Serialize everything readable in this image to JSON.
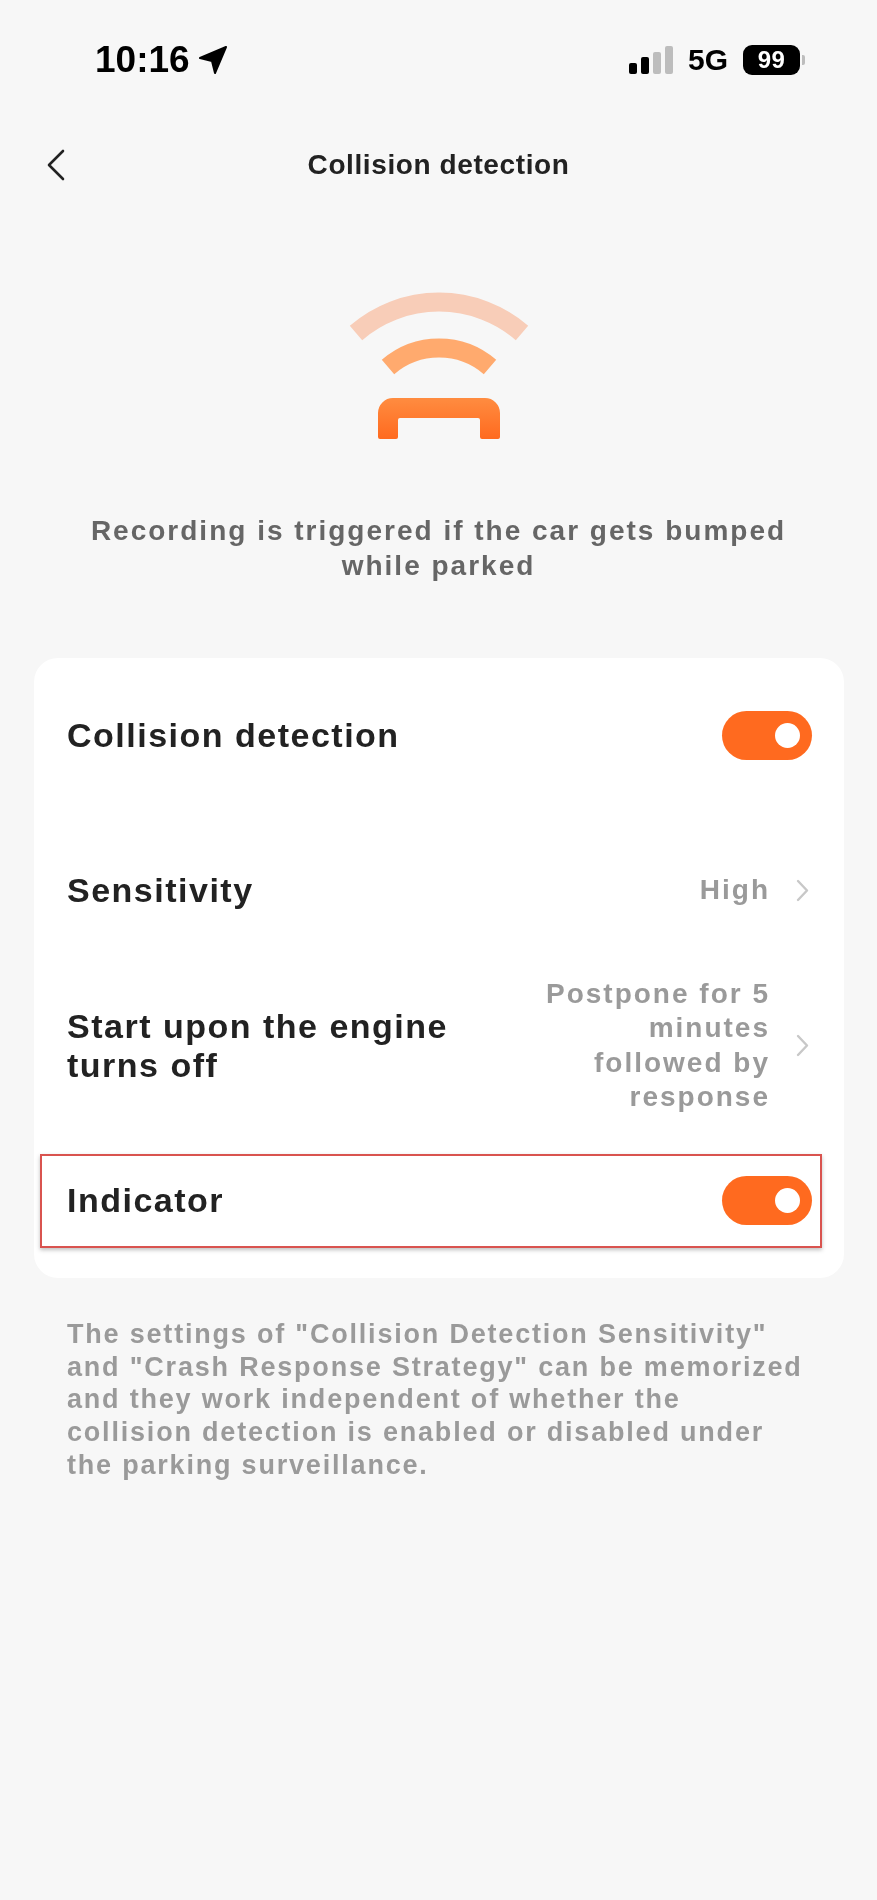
{
  "status_bar": {
    "time": "10:16",
    "network": "5G",
    "battery": "99"
  },
  "header": {
    "title": "Collision detection"
  },
  "description": "Recording is triggered if the car gets bumped while parked",
  "settings": [
    {
      "kind": "toggle",
      "label": "Collision detection",
      "on": true,
      "highlighted": false
    },
    {
      "kind": "link",
      "label": "Sensitivity",
      "value": "High",
      "highlighted": false
    },
    {
      "kind": "link",
      "label": "Start upon the engine turns off",
      "value": "Postpone for 5 minutes followed by response",
      "highlighted": false
    },
    {
      "kind": "toggle",
      "label": "Indicator",
      "on": true,
      "highlighted": true
    }
  ],
  "footer_note": "The settings of \"Collision Detection Sensitivity\" and \"Crash Response Strategy\" can be memorized and they work independent of whether the collision detection is enabled or disabled under the parking surveillance."
}
